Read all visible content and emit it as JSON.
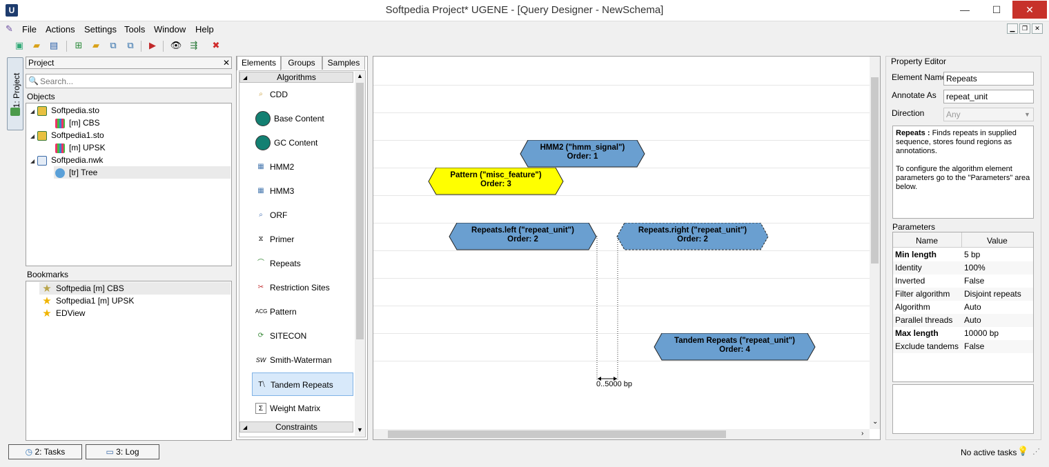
{
  "window": {
    "title": "Softpedia Project* UGENE - [Query Designer - NewSchema]",
    "app_icon_letter": "U",
    "minimize": "—",
    "maximize": "☐",
    "close": "✕"
  },
  "menu": {
    "items": [
      "File",
      "Actions",
      "Settings",
      "Tools",
      "Window",
      "Help"
    ]
  },
  "side_tab": {
    "label": "1: Project"
  },
  "project": {
    "header": "Project",
    "close": "✕",
    "search_placeholder": "Search...",
    "objects_label": "Objects",
    "tree": [
      {
        "label": "Softpedia.sto",
        "level": 0
      },
      {
        "label": "[m] CBS",
        "level": 1
      },
      {
        "label": "Softpedia1.sto",
        "level": 0
      },
      {
        "label": "[m] UPSK",
        "level": 1
      },
      {
        "label": "Softpedia.nwk",
        "level": 0
      },
      {
        "label": "[tr] Tree",
        "level": 1
      }
    ],
    "bookmarks_label": "Bookmarks",
    "bookmarks": [
      "Softpedia [m] CBS",
      "Softpedia1 [m] UPSK",
      "EDView"
    ]
  },
  "palette": {
    "tabs": [
      "Elements",
      "Groups",
      "Samples"
    ],
    "section_algorithms": "Algorithms",
    "section_constraints": "Constraints",
    "items": [
      "CDD",
      "Base Content",
      "GC Content",
      "HMM2",
      "HMM3",
      "ORF",
      "Primer",
      "Repeats",
      "Restriction Sites",
      "Pattern",
      "SITECON",
      "Smith-Waterman",
      "Tandem Repeats",
      "Weight Matrix"
    ],
    "selected": "Tandem Repeats"
  },
  "canvas": {
    "nodes": [
      {
        "line1": "HMM2 (\"hmm_signal\")",
        "line2": "Order: 1"
      },
      {
        "line1": "Pattern (\"misc_feature\")",
        "line2": "Order: 3"
      },
      {
        "line1": "Repeats.left (\"repeat_unit\")",
        "line2": "Order: 2"
      },
      {
        "line1": "Repeats.right (\"repeat_unit\")",
        "line2": "Order: 2"
      },
      {
        "line1": "Tandem Repeats (\"repeat_unit\")",
        "line2": "Order: 4"
      }
    ],
    "distance_label": "0..5000 bp",
    "colors": {
      "node_blue": "#6a9fd0",
      "node_yellow": "#ffff00"
    }
  },
  "property_editor": {
    "title": "Property Editor",
    "element_name_label": "Element Name",
    "element_name_value": "Repeats",
    "annotate_as_label": "Annotate As",
    "annotate_as_value": "repeat_unit",
    "direction_label": "Direction",
    "direction_value": "Any",
    "description_title": "Repeats :",
    "description_body": " Finds repeats in supplied sequence, stores found regions as annotations.",
    "description_hint": "To configure the algorithm element parameters go to the \"Parameters\" area below.",
    "parameters_label": "Parameters",
    "col_name": "Name",
    "col_value": "Value",
    "params": [
      {
        "name": "Min length",
        "value": "5 bp"
      },
      {
        "name": "Identity",
        "value": "100%"
      },
      {
        "name": "Inverted",
        "value": "False"
      },
      {
        "name": "Filter algorithm",
        "value": "Disjoint repeats"
      },
      {
        "name": "Algorithm",
        "value": "Auto"
      },
      {
        "name": "Parallel threads",
        "value": "Auto"
      },
      {
        "name": "Max length",
        "value": "10000 bp"
      },
      {
        "name": "Exclude tandems",
        "value": "False"
      }
    ]
  },
  "bottom": {
    "tasks_btn": "2: Tasks",
    "log_btn": "3: Log",
    "status": "No active tasks"
  }
}
